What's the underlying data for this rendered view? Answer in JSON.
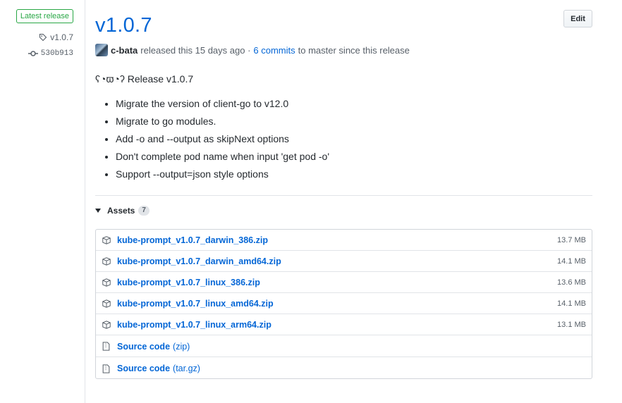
{
  "sidebar": {
    "badge": "Latest release",
    "tag": "v1.0.7",
    "commit": "530b913"
  },
  "release": {
    "title": "v1.0.7",
    "edit_label": "Edit",
    "author": "c-bata",
    "released_text": "released this 15 days ago ·",
    "commits_link": "6 commits",
    "since_text": "to master since this release",
    "heading": "ʕ◔ϖ◔ʔ Release v1.0.7",
    "notes": [
      "Migrate the version of client-go to v12.0",
      "Migrate to go modules.",
      "Add -o and --output as skipNext options",
      "Don't complete pod name when input 'get pod -o'",
      "Support --output=json style options"
    ]
  },
  "assets": {
    "label": "Assets",
    "count": "7",
    "files": [
      {
        "name": "kube-prompt_v1.0.7_darwin_386.zip",
        "size": "13.7 MB"
      },
      {
        "name": "kube-prompt_v1.0.7_darwin_amd64.zip",
        "size": "14.1 MB"
      },
      {
        "name": "kube-prompt_v1.0.7_linux_386.zip",
        "size": "13.6 MB"
      },
      {
        "name": "kube-prompt_v1.0.7_linux_amd64.zip",
        "size": "14.1 MB"
      },
      {
        "name": "kube-prompt_v1.0.7_linux_arm64.zip",
        "size": "13.1 MB"
      }
    ],
    "sources": [
      {
        "label": "Source code",
        "suffix": "(zip)"
      },
      {
        "label": "Source code",
        "suffix": "(tar.gz)"
      }
    ]
  },
  "colors": {
    "link": "#0366d6",
    "latest_badge": "#28a745"
  }
}
